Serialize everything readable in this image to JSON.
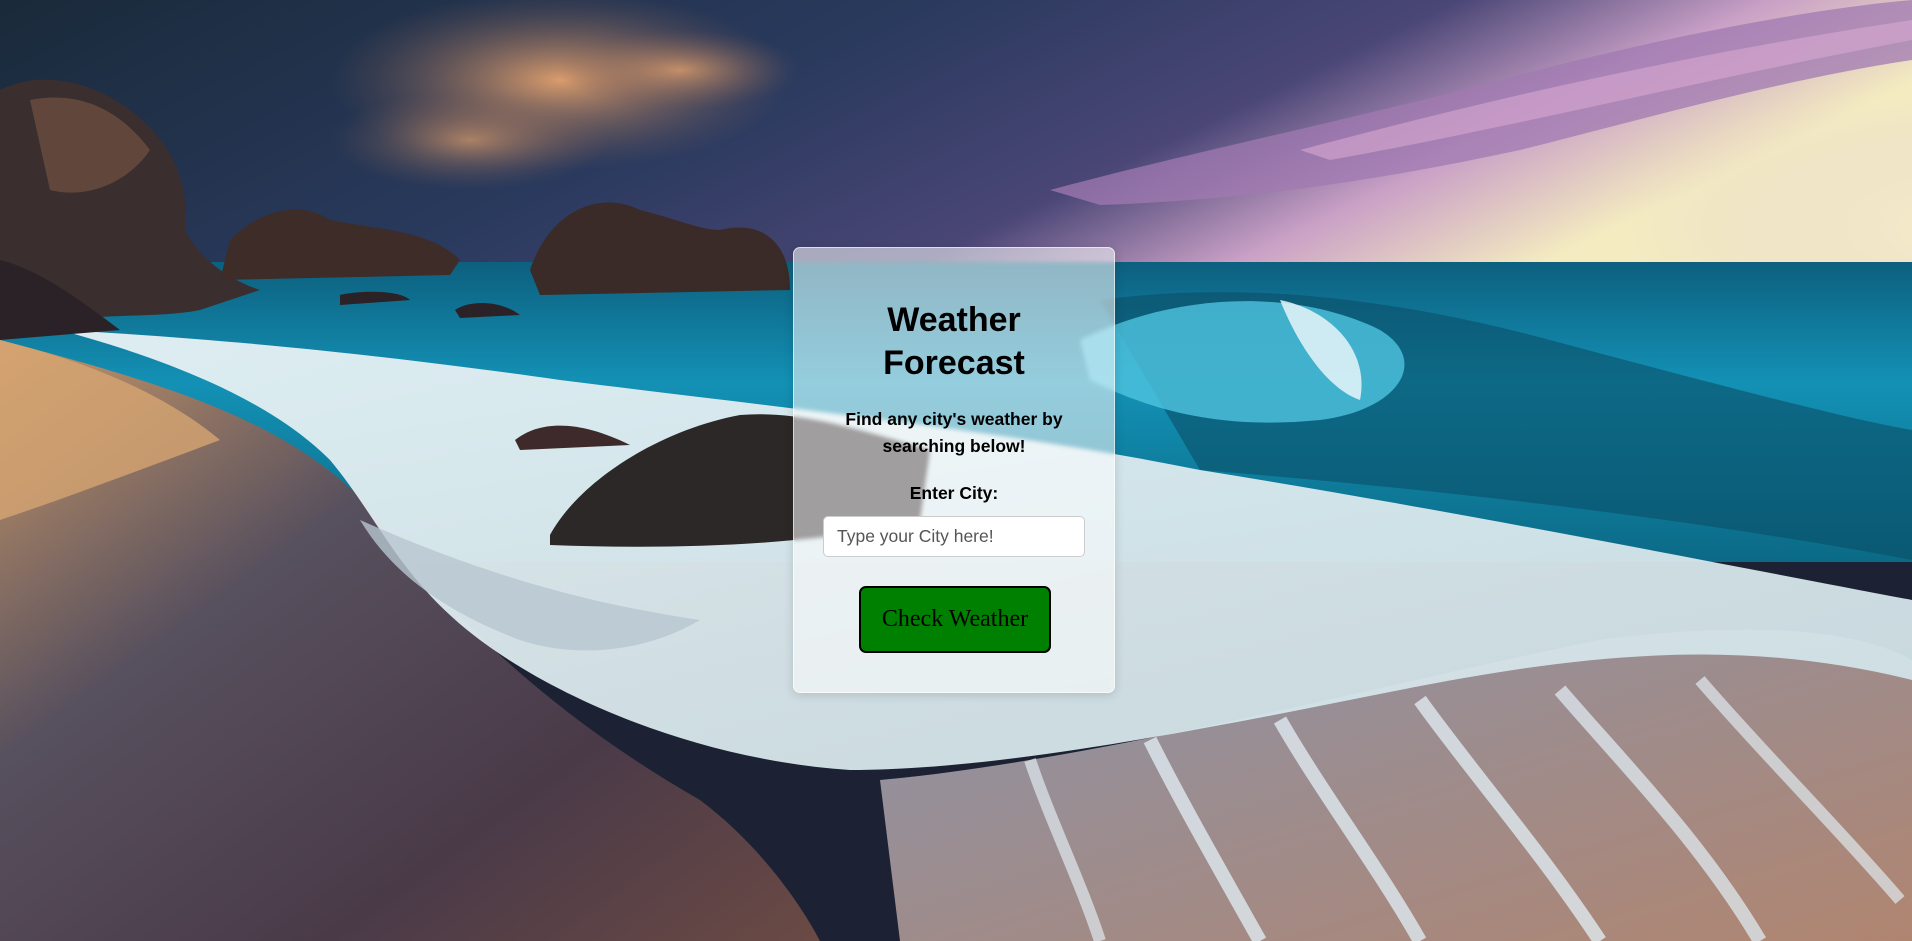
{
  "page": {
    "title": "Weather Forecast",
    "subtitle": "Find any city's weather by searching below!"
  },
  "form": {
    "city_label": "Enter City:",
    "city_value": "",
    "city_placeholder": "Type your City here!",
    "submit_label": "Check Weather"
  },
  "colors": {
    "button_background": "#008000",
    "card_background": "rgba(255,255,255,0.55)"
  },
  "background": {
    "icon": "beach-sunset-photo"
  }
}
